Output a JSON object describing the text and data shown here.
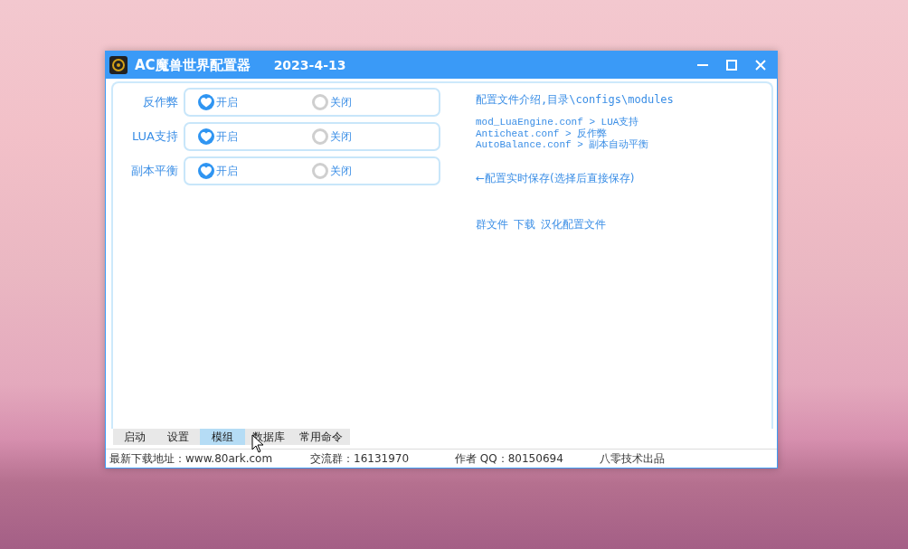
{
  "window": {
    "title": "AC魔兽世界配置器",
    "date": "2023-4-13"
  },
  "settings": [
    {
      "label": "反作弊",
      "options": [
        {
          "label": "开启",
          "selected": true
        },
        {
          "label": "关闭",
          "selected": false
        }
      ]
    },
    {
      "label": "LUA支持",
      "options": [
        {
          "label": "开启",
          "selected": true
        },
        {
          "label": "关闭",
          "selected": false
        }
      ]
    },
    {
      "label": "副本平衡",
      "options": [
        {
          "label": "开启",
          "selected": true
        },
        {
          "label": "关闭",
          "selected": false
        }
      ]
    }
  ],
  "info": {
    "heading": "配置文件介绍,目录\\configs\\modules",
    "files": [
      {
        "file": "mod_LuaEngine.conf",
        "desc": "> LUA支持"
      },
      {
        "file": "Anticheat.conf",
        "desc": "> 反作弊"
      },
      {
        "file": "AutoBalance.conf",
        "desc": "> 副本自动平衡"
      }
    ],
    "note": "←配置实时保存(选择后直接保存)",
    "links": [
      "群文件",
      "下载",
      "汉化配置文件"
    ]
  },
  "tabs": [
    {
      "label": "启动",
      "selected": false
    },
    {
      "label": "设置",
      "selected": false
    },
    {
      "label": "模组",
      "selected": true
    },
    {
      "label": "数据库",
      "selected": false
    },
    {
      "label": "常用命令",
      "selected": false
    }
  ],
  "status_bar": [
    "最新下载地址：www.80ark.com",
    "交流群：16131970",
    "作者 QQ：80150694",
    "八零技术出品"
  ]
}
